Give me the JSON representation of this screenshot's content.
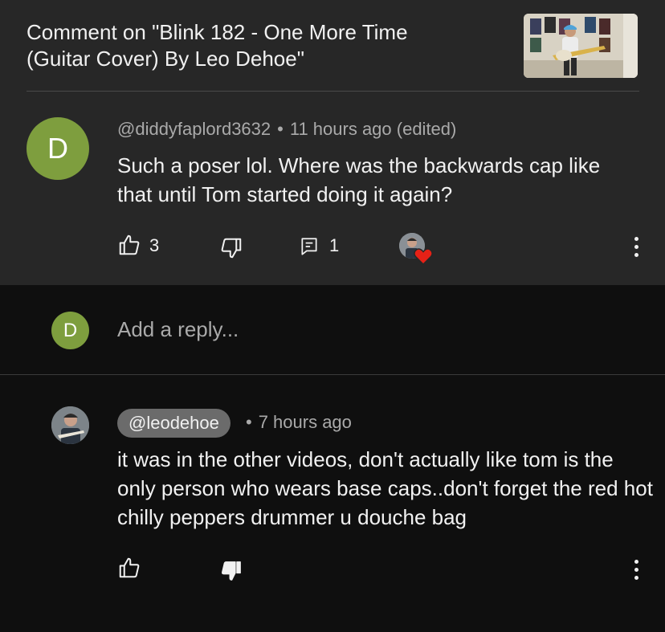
{
  "header": {
    "title": "Comment on \"Blink 182 - One More Time (Guitar Cover) By Leo Dehoe\""
  },
  "comment": {
    "avatar_letter": "D",
    "author": "@diddyfaplord3632",
    "separator": "•",
    "time": "11 hours ago (edited)",
    "text": "Such a poser lol. Where was the backwards cap like that until Tom started doing it again?",
    "likes": "3",
    "replies": "1"
  },
  "reply_box": {
    "avatar_letter": "D",
    "placeholder": "Add a reply..."
  },
  "reply": {
    "author": "@leodehoe",
    "separator": "•",
    "time": "7 hours ago",
    "text": "it was in the other videos, don't actually like tom is the only person who wears base caps..don't forget the red hot chilly peppers drummer u douche bag"
  },
  "colors": {
    "top_background": "#272727",
    "page_background": "#0f0f0f",
    "avatar_green": "#7e9e3e",
    "heart_red": "#e62117",
    "handle_pill": "#6b6b6b"
  },
  "icons": [
    "thumbs-up-icon",
    "thumbs-down-icon",
    "reply-icon",
    "creator-heart-icon",
    "more-vert-icon",
    "thumbs-down-filled-icon"
  ]
}
